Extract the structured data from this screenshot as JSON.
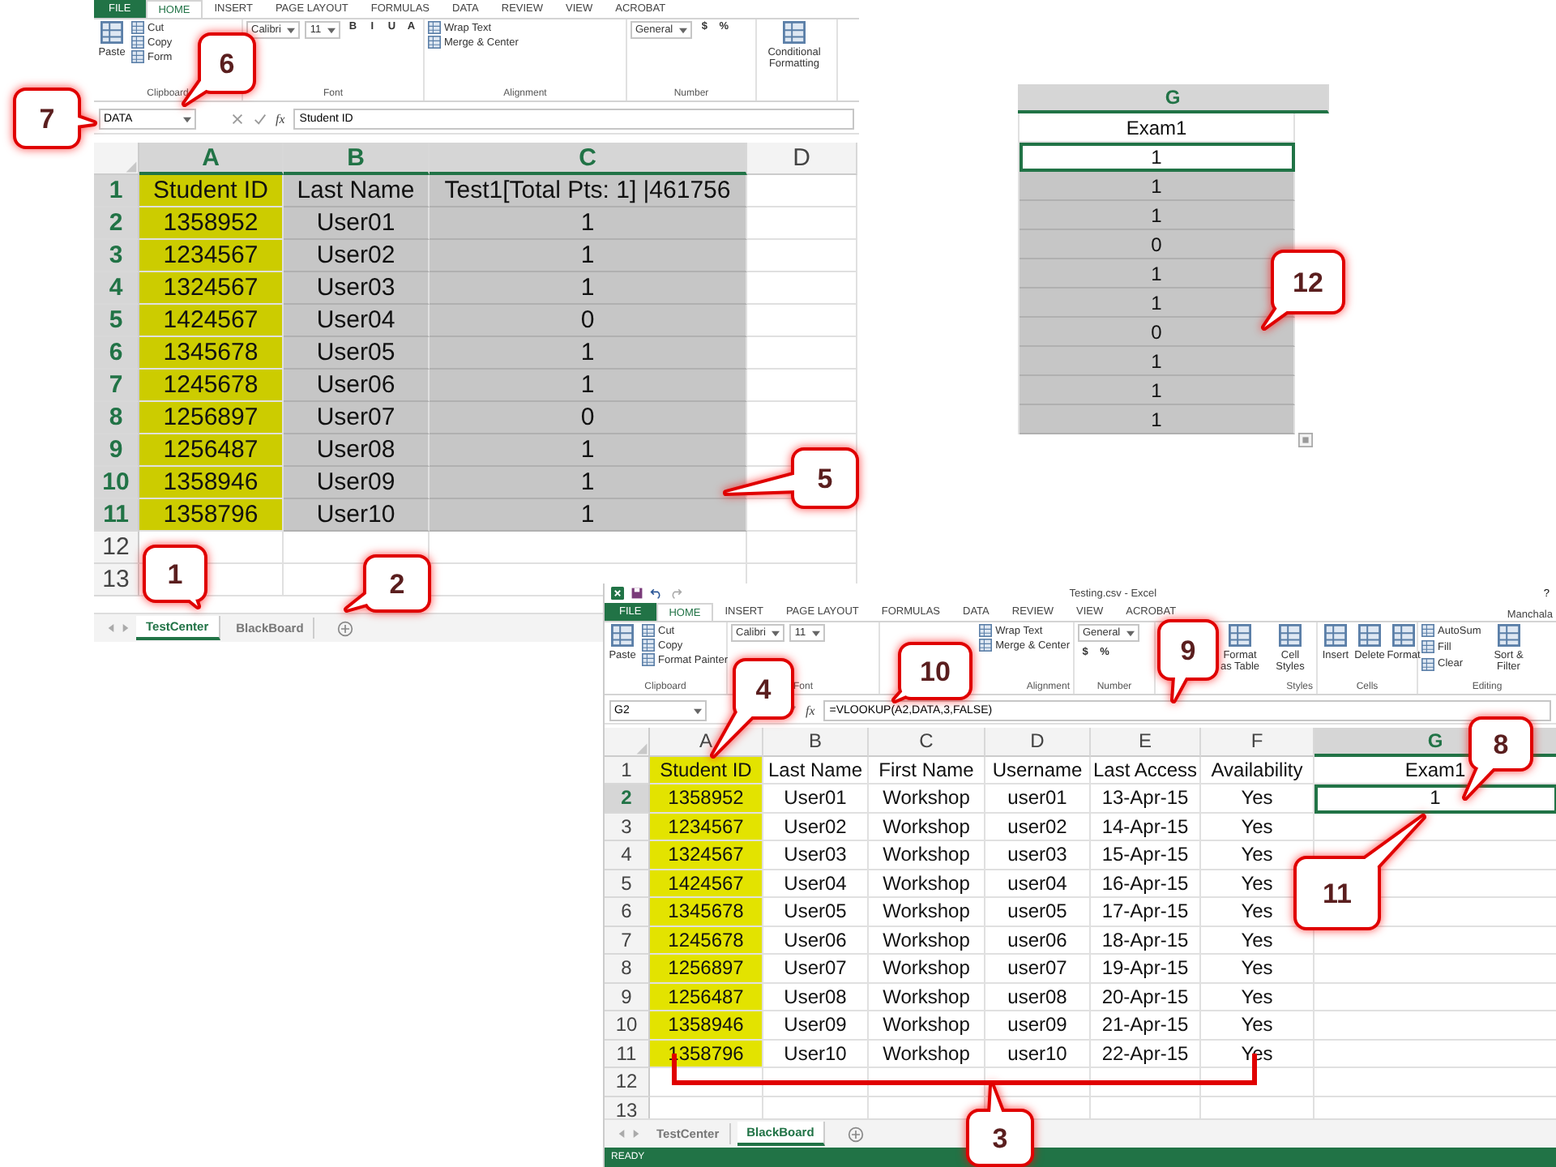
{
  "top_left_window": {
    "ribbon_tabs": [
      {
        "label": "FILE",
        "kind": "file",
        "selected": false
      },
      {
        "label": "HOME",
        "kind": "tab",
        "selected": true
      },
      {
        "label": "INSERT",
        "kind": "tab",
        "selected": false
      },
      {
        "label": "PAGE LAYOUT",
        "kind": "tab",
        "selected": false
      },
      {
        "label": "FORMULAS",
        "kind": "tab",
        "selected": false
      },
      {
        "label": "DATA",
        "kind": "tab",
        "selected": false
      },
      {
        "label": "REVIEW",
        "kind": "tab",
        "selected": false
      },
      {
        "label": "VIEW",
        "kind": "tab",
        "selected": false
      },
      {
        "label": "ACROBAT",
        "kind": "tab",
        "selected": false
      }
    ],
    "ribbon_groups": [
      {
        "label": "Clipboard",
        "items": [
          {
            "kind": "large",
            "label": "Paste"
          },
          {
            "kind": "small",
            "label": "Cut"
          },
          {
            "kind": "small",
            "label": "Copy"
          },
          {
            "kind": "small",
            "label": "Form"
          }
        ]
      },
      {
        "label": "Font",
        "kind": "flow",
        "items": [
          {
            "kind": "dropdown",
            "label": "Calibri"
          },
          {
            "kind": "dropdown",
            "label": "11"
          },
          {
            "kind": "glyph",
            "label": "B"
          },
          {
            "kind": "glyph",
            "label": "I"
          },
          {
            "kind": "glyph",
            "label": "U"
          },
          {
            "kind": "glyph",
            "label": "A"
          }
        ]
      },
      {
        "label": "Alignment",
        "items": [
          {
            "kind": "small",
            "label": "Wrap Text"
          },
          {
            "kind": "small",
            "label": "Merge & Center"
          }
        ]
      },
      {
        "label": "Number",
        "kind": "flow",
        "items": [
          {
            "kind": "dropdown",
            "label": "General"
          },
          {
            "kind": "glyph",
            "label": "$"
          },
          {
            "kind": "glyph",
            "label": "%"
          }
        ]
      },
      {
        "items": [
          {
            "kind": "large",
            "label": "Conditional Formatting"
          }
        ]
      }
    ],
    "formula_bar": {
      "name_box": "DATA",
      "function_label": "fx",
      "formula": "Student ID"
    },
    "sheet": {
      "range_selected": true,
      "columns": [
        {
          "label": "A",
          "selected": true,
          "highlight": true
        },
        {
          "label": "B",
          "selected": true,
          "highlight": false
        },
        {
          "label": "C",
          "selected": true,
          "highlight": false
        },
        {
          "label": "D",
          "selected": false,
          "highlight": false
        }
      ],
      "rows": [
        {
          "header": "1",
          "selected": true,
          "highlight": true,
          "cells": [
            "Student ID",
            "Last Name",
            "Test1[Total Pts: 1] |461756"
          ]
        },
        {
          "header": "2",
          "selected": true,
          "highlight": true,
          "cells": [
            "1358952",
            "User01",
            "1"
          ]
        },
        {
          "header": "3",
          "selected": true,
          "highlight": true,
          "cells": [
            "1234567",
            "User02",
            "1"
          ]
        },
        {
          "header": "4",
          "selected": true,
          "highlight": true,
          "cells": [
            "1324567",
            "User03",
            "1"
          ]
        },
        {
          "header": "5",
          "selected": true,
          "highlight": true,
          "cells": [
            "1424567",
            "User04",
            "0"
          ]
        },
        {
          "header": "6",
          "selected": true,
          "highlight": true,
          "cells": [
            "1345678",
            "User05",
            "1"
          ]
        },
        {
          "header": "7",
          "selected": true,
          "highlight": true,
          "cells": [
            "1245678",
            "User06",
            "1"
          ]
        },
        {
          "header": "8",
          "selected": true,
          "highlight": true,
          "cells": [
            "1256897",
            "User07",
            "0"
          ]
        },
        {
          "header": "9",
          "selected": true,
          "highlight": true,
          "cells": [
            "1256487",
            "User08",
            "1"
          ]
        },
        {
          "header": "10",
          "selected": true,
          "highlight": true,
          "cells": [
            "1358946",
            "User09",
            "1"
          ]
        },
        {
          "header": "11",
          "selected": true,
          "highlight": true,
          "cells": [
            "1358796",
            "User10",
            "1"
          ]
        },
        {
          "header": "12",
          "selected": false,
          "highlight": false
        },
        {
          "header": "13",
          "selected": false,
          "highlight": false
        }
      ]
    },
    "sheet_tabs": [
      {
        "label": "TestCenter",
        "selected": true
      },
      {
        "label": "BlackBoard",
        "selected": false
      }
    ]
  },
  "top_right_clip": {
    "column": {
      "label": "G",
      "selected": true
    },
    "cells": [
      {
        "value": "Exam1",
        "selected": false,
        "active": false
      },
      {
        "value": "1",
        "selected": true,
        "active": true
      },
      {
        "value": "1",
        "selected": true,
        "active": false
      },
      {
        "value": "1",
        "selected": true,
        "active": false
      },
      {
        "value": "0",
        "selected": true,
        "active": false
      },
      {
        "value": "1",
        "selected": true,
        "active": false
      },
      {
        "value": "1",
        "selected": true,
        "active": false
      },
      {
        "value": "0",
        "selected": true,
        "active": false
      },
      {
        "value": "1",
        "selected": true,
        "active": false
      },
      {
        "value": "1",
        "selected": true,
        "active": false
      },
      {
        "value": "1",
        "selected": true,
        "active": false
      }
    ]
  },
  "bottom_right_window": {
    "title": "Testing.csv - Excel",
    "help": "?",
    "user": "Manchala",
    "ribbon_tabs": [
      {
        "label": "FILE",
        "kind": "file",
        "selected": false
      },
      {
        "label": "HOME",
        "kind": "tab",
        "selected": true
      },
      {
        "label": "INSERT",
        "kind": "tab",
        "selected": false
      },
      {
        "label": "PAGE LAYOUT",
        "kind": "tab",
        "selected": false
      },
      {
        "label": "FORMULAS",
        "kind": "tab",
        "selected": false
      },
      {
        "label": "DATA",
        "kind": "tab",
        "selected": false
      },
      {
        "label": "REVIEW",
        "kind": "tab",
        "selected": false
      },
      {
        "label": "VIEW",
        "kind": "tab",
        "selected": false
      },
      {
        "label": "ACROBAT",
        "kind": "tab",
        "selected": false
      }
    ],
    "ribbon_groups": [
      {
        "label": "Clipboard",
        "items": [
          {
            "kind": "large",
            "label": "Paste"
          },
          {
            "kind": "small",
            "label": "Cut"
          },
          {
            "kind": "small",
            "label": "Copy"
          },
          {
            "kind": "small",
            "label": "Format Painter"
          }
        ]
      },
      {
        "label": "Font",
        "kind": "flow",
        "items": [
          {
            "kind": "dropdown",
            "label": "Calibri"
          },
          {
            "kind": "dropdown",
            "label": "11"
          }
        ]
      },
      {
        "label": "Alignment",
        "items": [
          {
            "kind": "small",
            "label": "Wrap Text"
          },
          {
            "kind": "small",
            "label": "Merge & Center"
          }
        ]
      },
      {
        "label": "Number",
        "kind": "flow",
        "items": [
          {
            "kind": "dropdown",
            "label": "General"
          },
          {
            "kind": "glyph",
            "label": "$"
          },
          {
            "kind": "glyph",
            "label": "%"
          }
        ]
      },
      {
        "label": "Styles",
        "items": [
          {
            "kind": "large",
            "label": "Format as Table"
          },
          {
            "kind": "large",
            "label": "Cell Styles"
          }
        ]
      },
      {
        "label": "Cells",
        "items": [
          {
            "kind": "large",
            "label": "Insert"
          },
          {
            "kind": "large",
            "label": "Delete"
          },
          {
            "kind": "large",
            "label": "Format"
          }
        ]
      },
      {
        "label": "Editing",
        "items": [
          {
            "kind": "small",
            "label": "AutoSum"
          },
          {
            "kind": "small",
            "label": "Fill"
          },
          {
            "kind": "small",
            "label": "Clear"
          },
          {
            "kind": "large",
            "label": "Sort & Filter"
          }
        ]
      }
    ],
    "formula_bar": {
      "name_box": "G2",
      "function_label": "fx",
      "formula": "=VLOOKUP(A2,DATA,3,FALSE)"
    },
    "sheet": {
      "range_selected": false,
      "columns": [
        {
          "label": "A",
          "selected": false,
          "highlight": true
        },
        {
          "label": "B",
          "selected": false,
          "highlight": false
        },
        {
          "label": "C",
          "selected": false,
          "highlight": false
        },
        {
          "label": "D",
          "selected": false,
          "highlight": false
        },
        {
          "label": "E",
          "selected": false,
          "highlight": false
        },
        {
          "label": "F",
          "selected": false,
          "highlight": false
        },
        {
          "label": "G",
          "selected": true,
          "highlight": false
        }
      ],
      "rows": [
        {
          "header": "1",
          "selected": false,
          "highlight": true,
          "cells": [
            "Student ID",
            "Last Name",
            "First Name",
            "Username",
            "Last Access",
            "Availability",
            "Exam1"
          ]
        },
        {
          "header": "2",
          "selected": true,
          "highlight": true,
          "cells": [
            "1358952",
            "User01",
            "Workshop",
            "user01",
            "13-Apr-15",
            "Yes",
            "1"
          ]
        },
        {
          "header": "3",
          "selected": false,
          "highlight": true,
          "cells": [
            "1234567",
            "User02",
            "Workshop",
            "user02",
            "14-Apr-15",
            "Yes"
          ]
        },
        {
          "header": "4",
          "selected": false,
          "highlight": true,
          "cells": [
            "1324567",
            "User03",
            "Workshop",
            "user03",
            "15-Apr-15",
            "Yes"
          ]
        },
        {
          "header": "5",
          "selected": false,
          "highlight": true,
          "cells": [
            "1424567",
            "User04",
            "Workshop",
            "user04",
            "16-Apr-15",
            "Yes"
          ]
        },
        {
          "header": "6",
          "selected": false,
          "highlight": true,
          "cells": [
            "1345678",
            "User05",
            "Workshop",
            "user05",
            "17-Apr-15",
            "Yes"
          ]
        },
        {
          "header": "7",
          "selected": false,
          "highlight": true,
          "cells": [
            "1245678",
            "User06",
            "Workshop",
            "user06",
            "18-Apr-15",
            "Yes"
          ]
        },
        {
          "header": "8",
          "selected": false,
          "highlight": true,
          "cells": [
            "1256897",
            "User07",
            "Workshop",
            "user07",
            "19-Apr-15",
            "Yes"
          ]
        },
        {
          "header": "9",
          "selected": false,
          "highlight": true,
          "cells": [
            "1256487",
            "User08",
            "Workshop",
            "user08",
            "20-Apr-15",
            "Yes"
          ]
        },
        {
          "header": "10",
          "selected": false,
          "highlight": true,
          "cells": [
            "1358946",
            "User09",
            "Workshop",
            "user09",
            "21-Apr-15",
            "Yes"
          ]
        },
        {
          "header": "11",
          "selected": false,
          "highlight": true,
          "cells": [
            "1358796",
            "User10",
            "Workshop",
            "user10",
            "22-Apr-15",
            "Yes"
          ]
        },
        {
          "header": "12",
          "selected": false,
          "highlight": false
        },
        {
          "header": "13",
          "selected": false,
          "highlight": false
        }
      ]
    },
    "sheet_tabs": [
      {
        "label": "TestCenter",
        "selected": false
      },
      {
        "label": "BlackBoard",
        "selected": true
      }
    ],
    "status": "READY"
  },
  "callouts": [
    "1",
    "2",
    "3",
    "4",
    "5",
    "6",
    "7",
    "8",
    "9",
    "10",
    "11",
    "12"
  ]
}
